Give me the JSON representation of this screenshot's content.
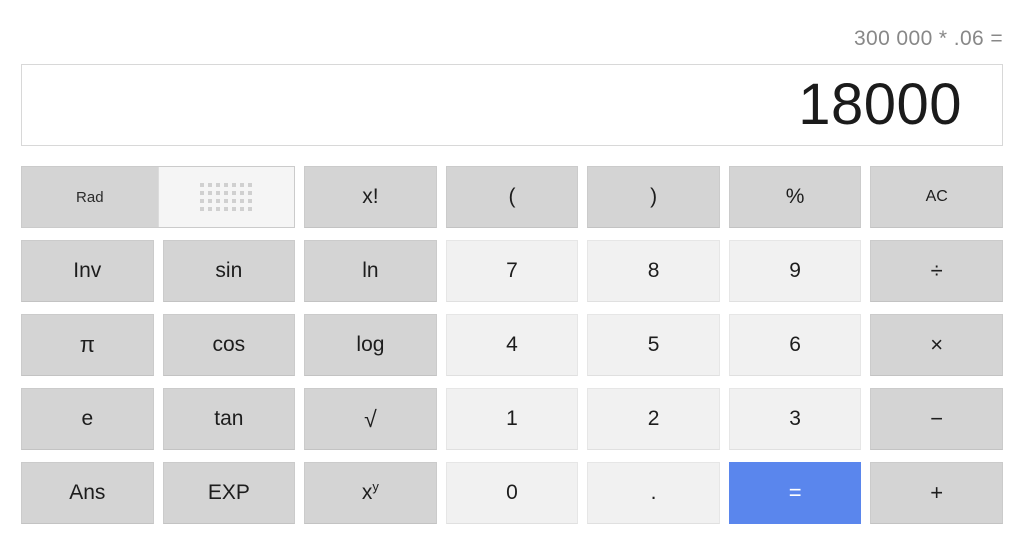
{
  "display": {
    "expression": "300 000 * .06 =",
    "result": "18000"
  },
  "toggle": {
    "angle_mode_label": "Rad",
    "keypad_icon_name": "dot-grid-icon"
  },
  "colors": {
    "key_gray": "#d4d4d4",
    "key_number": "#f1f1f1",
    "equals_blue": "#5a86ed",
    "text": "#1d1d1d",
    "expression_text": "#888888",
    "display_border": "#d8d8d8"
  },
  "keys": {
    "row1": [
      {
        "label": "x!",
        "type": "func"
      },
      {
        "label": "(",
        "type": "func"
      },
      {
        "label": ")",
        "type": "func"
      },
      {
        "label": "%",
        "type": "func"
      },
      {
        "label": "AC",
        "type": "func"
      }
    ],
    "row2": [
      {
        "label": "Inv",
        "type": "func"
      },
      {
        "label": "sin",
        "type": "func"
      },
      {
        "label": "ln",
        "type": "func"
      },
      {
        "label": "7",
        "type": "num"
      },
      {
        "label": "8",
        "type": "num"
      },
      {
        "label": "9",
        "type": "num"
      },
      {
        "label": "÷",
        "type": "op"
      }
    ],
    "row3": [
      {
        "label": "π",
        "type": "func"
      },
      {
        "label": "cos",
        "type": "func"
      },
      {
        "label": "log",
        "type": "func"
      },
      {
        "label": "4",
        "type": "num"
      },
      {
        "label": "5",
        "type": "num"
      },
      {
        "label": "6",
        "type": "num"
      },
      {
        "label": "×",
        "type": "op"
      }
    ],
    "row4": [
      {
        "label": "e",
        "type": "func"
      },
      {
        "label": "tan",
        "type": "func"
      },
      {
        "label": "√",
        "type": "func"
      },
      {
        "label": "1",
        "type": "num"
      },
      {
        "label": "2",
        "type": "num"
      },
      {
        "label": "3",
        "type": "num"
      },
      {
        "label": "−",
        "type": "op"
      }
    ],
    "row5": [
      {
        "label": "Ans",
        "type": "func"
      },
      {
        "label": "EXP",
        "type": "func"
      },
      {
        "label": "x",
        "sup": "y",
        "type": "func"
      },
      {
        "label": "0",
        "type": "num"
      },
      {
        "label": ".",
        "type": "num"
      },
      {
        "label": "=",
        "type": "equals"
      },
      {
        "label": "+",
        "type": "op"
      }
    ]
  }
}
